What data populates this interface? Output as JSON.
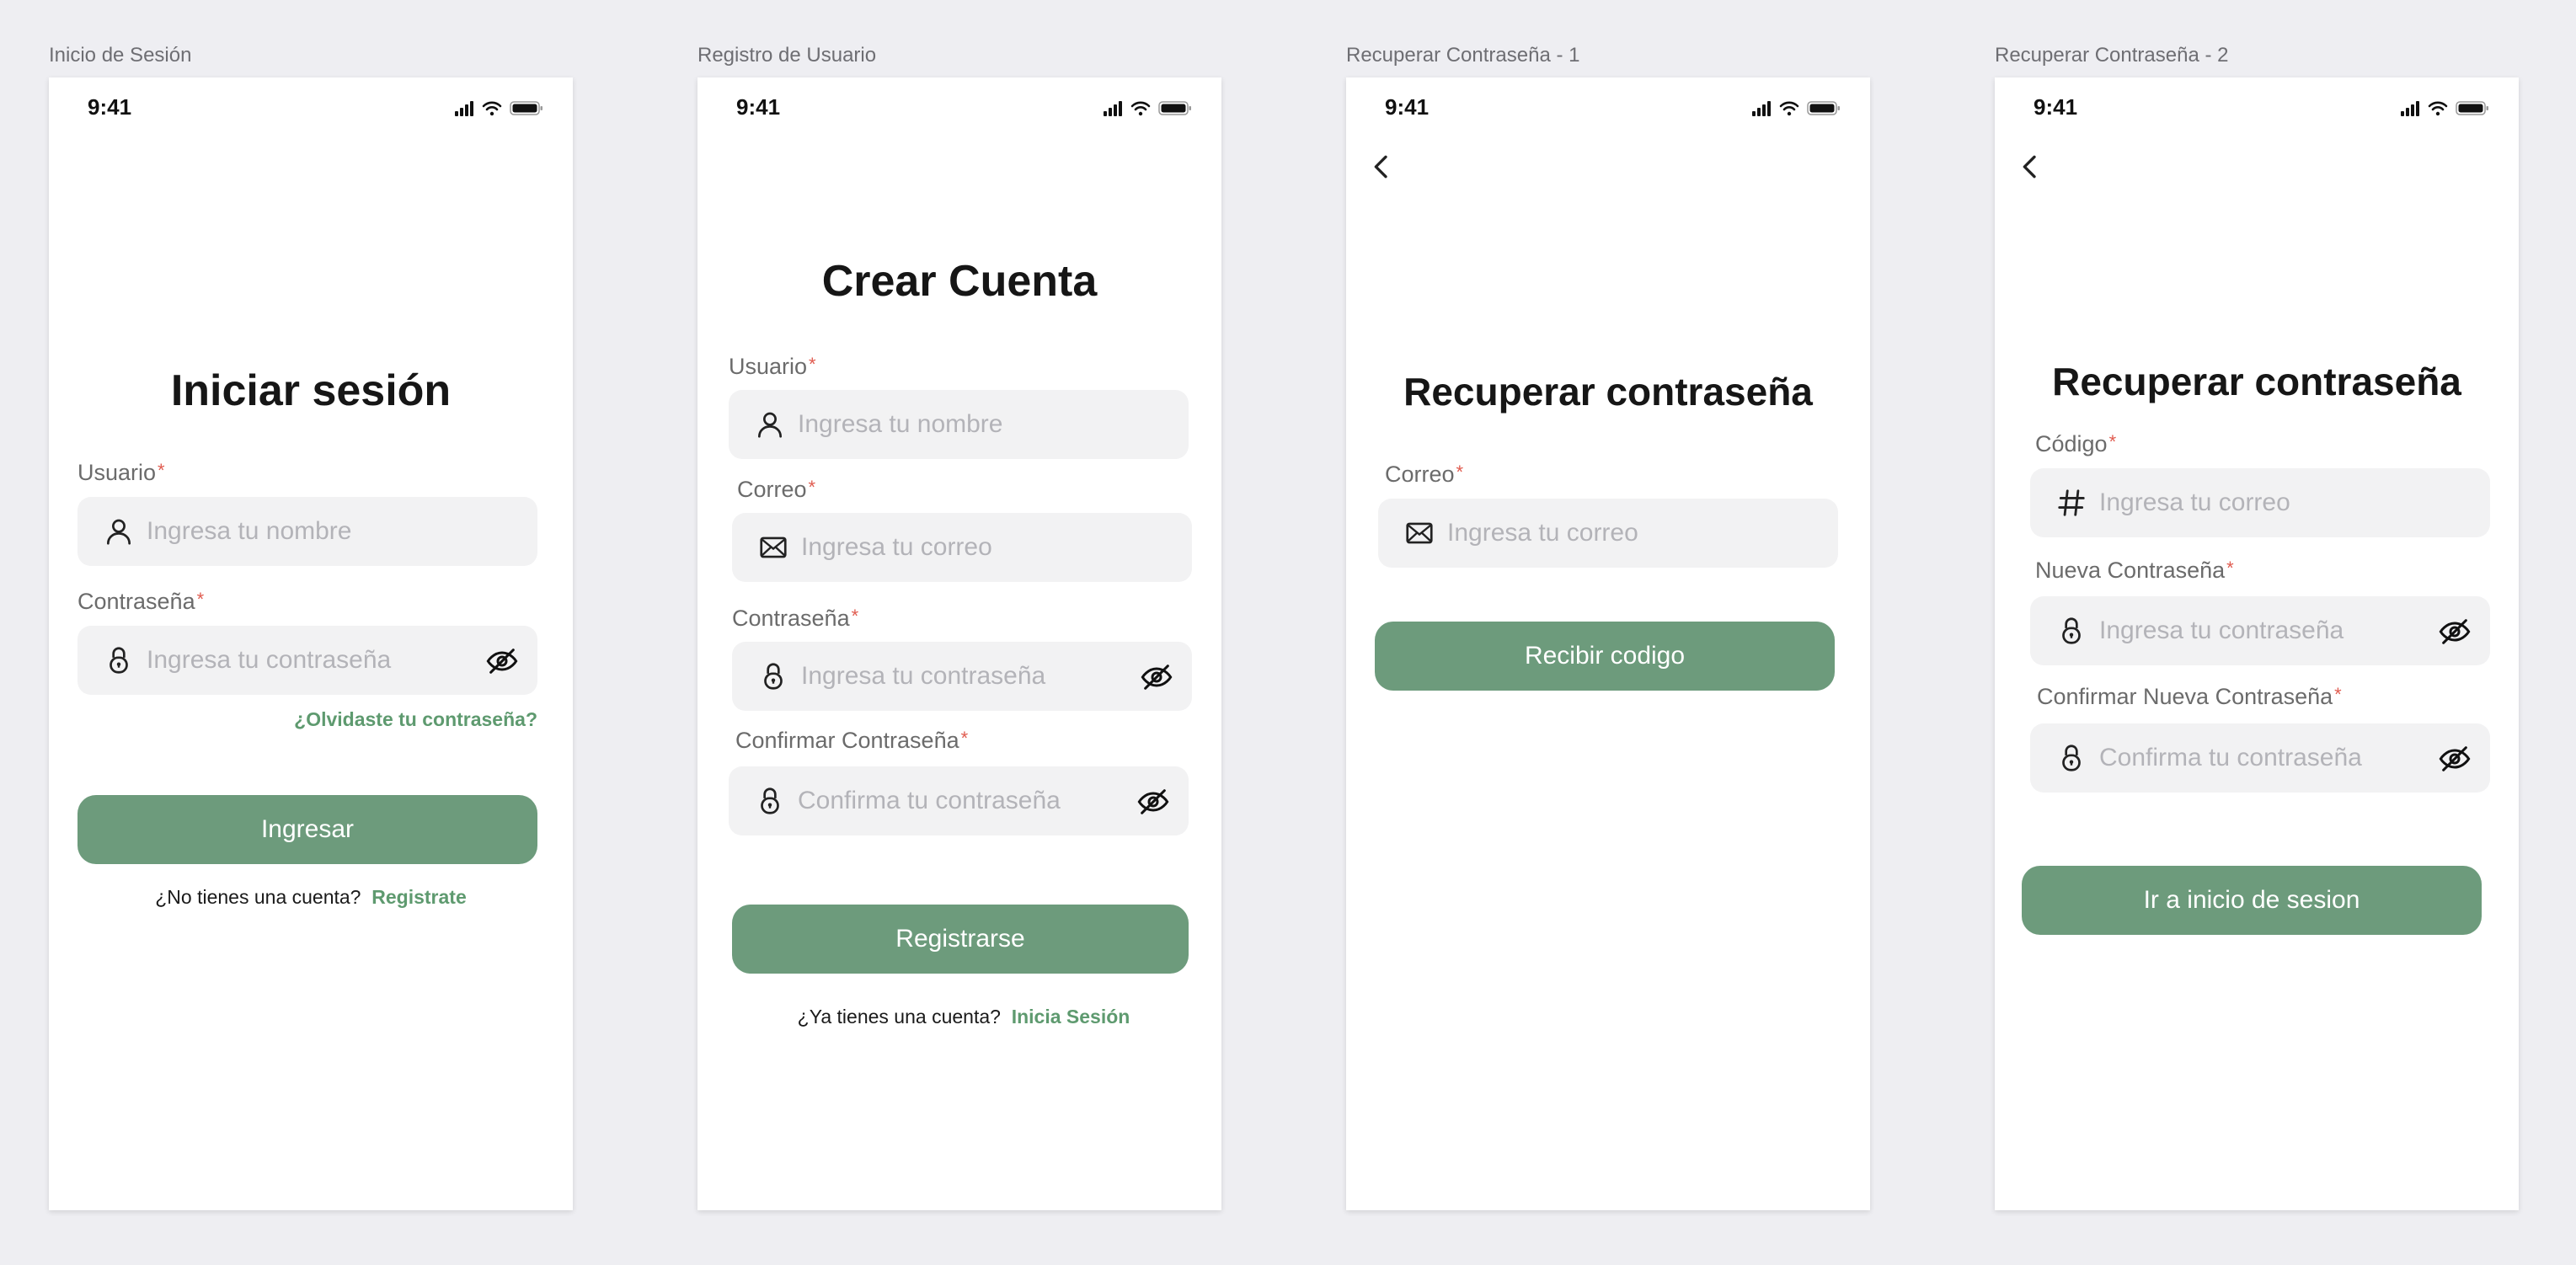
{
  "status": {
    "time": "9:41"
  },
  "screens": [
    {
      "frame_label": "Inicio de Sesión",
      "title": "Iniciar sesión",
      "user_label": "Usuario",
      "user_placeholder": "Ingresa tu nombre",
      "password_label": "Contraseña",
      "password_placeholder": "Ingresa tu contraseña",
      "forgot": "¿Olvidaste tu contraseña?",
      "button": "Ingresar",
      "footer_text": "¿No tienes una cuenta?",
      "footer_link": "Registrate"
    },
    {
      "frame_label": "Registro de Usuario",
      "title": "Crear Cuenta",
      "user_label": "Usuario",
      "user_placeholder": "Ingresa tu nombre",
      "email_label": "Correo",
      "email_placeholder": "Ingresa tu correo",
      "password_label": "Contraseña",
      "password_placeholder": "Ingresa tu contraseña",
      "confirm_label": "Confirmar Contraseña",
      "confirm_placeholder": "Confirma tu contraseña",
      "button": "Registrarse",
      "footer_text": "¿Ya tienes una cuenta?",
      "footer_link": "Inicia Sesión"
    },
    {
      "frame_label": "Recuperar Contraseña - 1",
      "title": "Recuperar contraseña",
      "email_label": "Correo",
      "email_placeholder": "Ingresa tu correo",
      "button": "Recibir codigo"
    },
    {
      "frame_label": "Recuperar Contraseña - 2",
      "title": "Recuperar contraseña",
      "code_label": "Código",
      "code_placeholder": "Ingresa tu correo",
      "new_password_label": "Nueva Contraseña",
      "new_password_placeholder": "Ingresa tu contraseña",
      "confirm_label": "Confirmar Nueva Contraseña",
      "confirm_placeholder": "Confirma tu contraseña",
      "button": "Ir a inicio de sesion"
    }
  ],
  "required_mark": "*",
  "colors": {
    "accent": "#6d9b7c",
    "link": "#5e9a6f",
    "required": "#e05b4f",
    "field_bg": "#f2f2f3"
  },
  "icons": [
    "user-icon",
    "mail-icon",
    "lock-icon",
    "eye-off-icon",
    "hash-icon",
    "back-chevron-icon",
    "signal-icon",
    "wifi-icon",
    "battery-icon"
  ]
}
